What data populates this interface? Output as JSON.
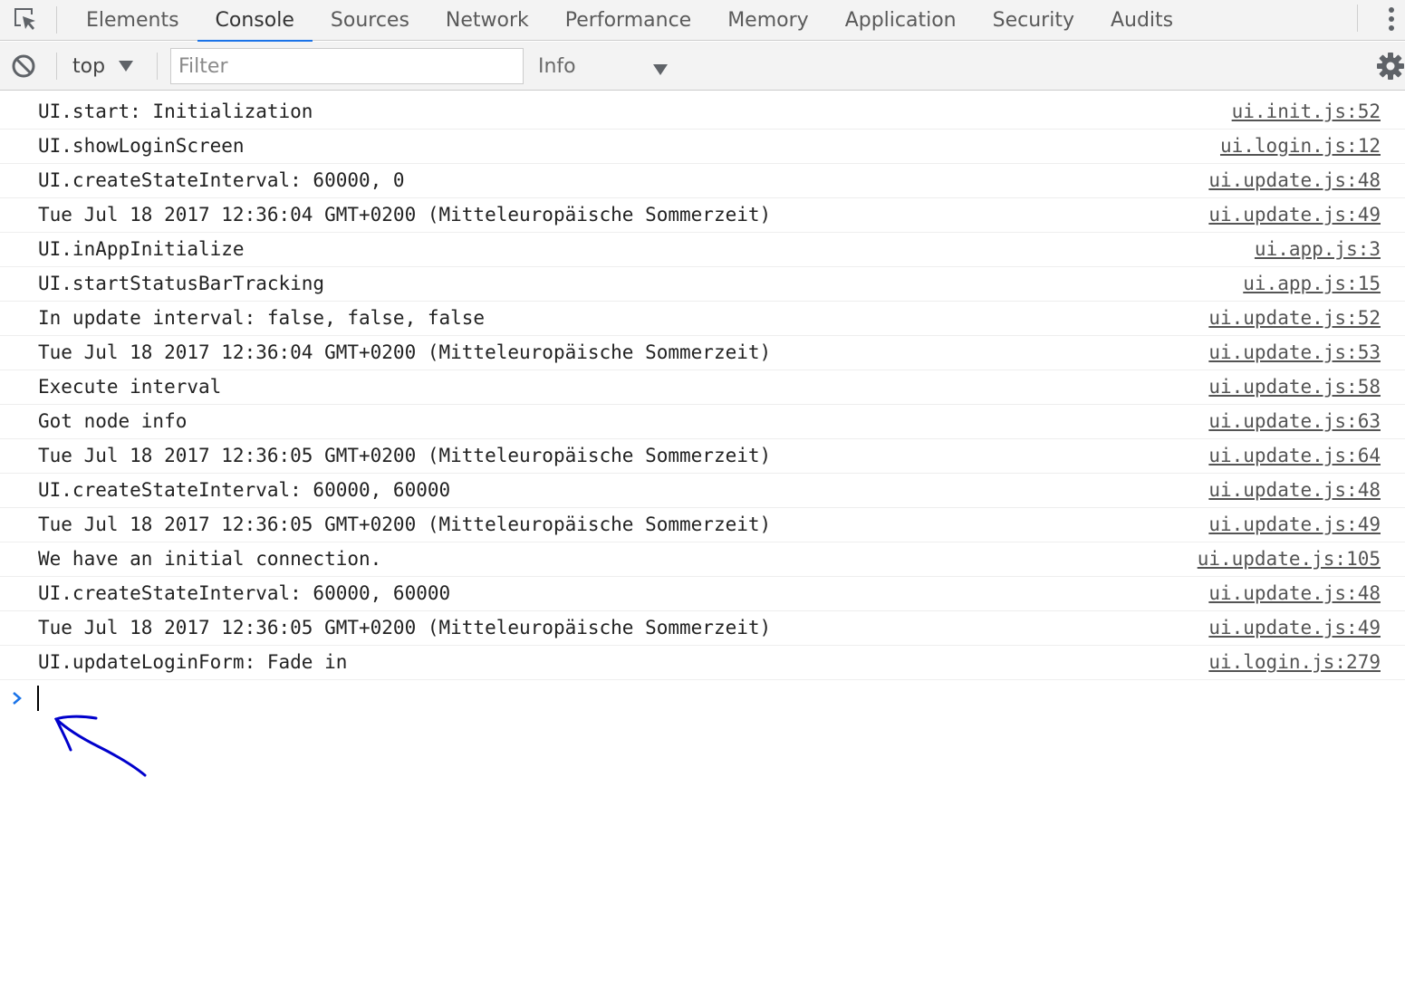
{
  "devtools": {
    "tabs": [
      {
        "label": "Elements"
      },
      {
        "label": "Console",
        "active": true
      },
      {
        "label": "Sources"
      },
      {
        "label": "Network"
      },
      {
        "label": "Performance"
      },
      {
        "label": "Memory"
      },
      {
        "label": "Application"
      },
      {
        "label": "Security"
      },
      {
        "label": "Audits"
      }
    ],
    "accent_color": "#1a73e8"
  },
  "toolbar": {
    "context_value": "top",
    "filter_placeholder": "Filter",
    "filter_value": "",
    "level_value": "Info"
  },
  "console": {
    "messages": [
      {
        "text": "UI.start: Initialization",
        "source": "ui.init.js:52"
      },
      {
        "text": "UI.showLoginScreen",
        "source": "ui.login.js:12"
      },
      {
        "text": "UI.createStateInterval: 60000, 0",
        "source": "ui.update.js:48"
      },
      {
        "text": "Tue Jul 18 2017 12:36:04 GMT+0200 (Mitteleuropäische Sommerzeit)",
        "source": "ui.update.js:49"
      },
      {
        "text": "UI.inAppInitialize",
        "source": "ui.app.js:3"
      },
      {
        "text": "UI.startStatusBarTracking",
        "source": "ui.app.js:15"
      },
      {
        "text": "In update interval: false, false, false",
        "source": "ui.update.js:52"
      },
      {
        "text": "Tue Jul 18 2017 12:36:04 GMT+0200 (Mitteleuropäische Sommerzeit)",
        "source": "ui.update.js:53"
      },
      {
        "text": "Execute interval",
        "source": "ui.update.js:58"
      },
      {
        "text": "Got node info",
        "source": "ui.update.js:63"
      },
      {
        "text": "Tue Jul 18 2017 12:36:05 GMT+0200 (Mitteleuropäische Sommerzeit)",
        "source": "ui.update.js:64"
      },
      {
        "text": "UI.createStateInterval: 60000, 60000",
        "source": "ui.update.js:48"
      },
      {
        "text": "Tue Jul 18 2017 12:36:05 GMT+0200 (Mitteleuropäische Sommerzeit)",
        "source": "ui.update.js:49"
      },
      {
        "text": "We have an initial connection.",
        "source": "ui.update.js:105"
      },
      {
        "text": "UI.createStateInterval: 60000, 60000",
        "source": "ui.update.js:48"
      },
      {
        "text": "Tue Jul 18 2017 12:36:05 GMT+0200 (Mitteleuropäische Sommerzeit)",
        "source": "ui.update.js:49"
      },
      {
        "text": "UI.updateLoginForm: Fade in",
        "source": "ui.login.js:279"
      }
    ],
    "prompt_value": "",
    "prompt_color": "#1a73e8",
    "annotation_color": "#0000cc"
  },
  "icons": {
    "inspect": "inspect-element-icon",
    "menu": "more-vertical-icon",
    "clear": "clear-console-icon",
    "dropdown": "dropdown-caret-icon",
    "settings": "gear-icon",
    "prompt": "chevron-right-icon",
    "annotation": "hand-drawn-arrow-icon"
  }
}
